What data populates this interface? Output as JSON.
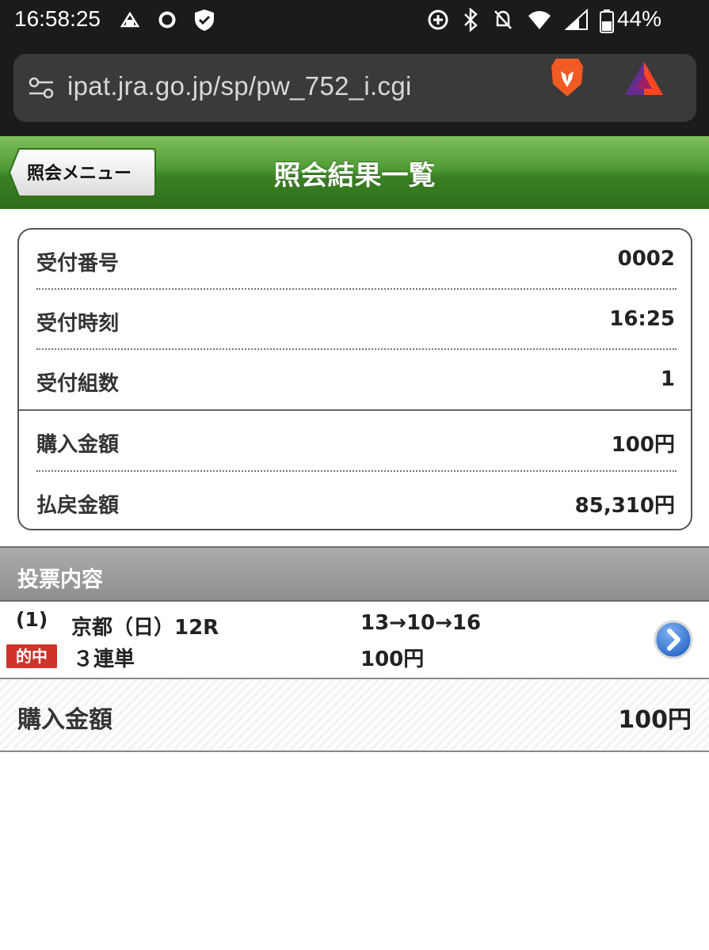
{
  "status_bar": {
    "time": "16:58:25",
    "battery": "44%"
  },
  "address_bar": {
    "url": "ipat.jra.go.jp/sp/pw_752_i.cgi"
  },
  "header": {
    "back_label": "照会メニュー",
    "title": "照会結果一覧"
  },
  "info": {
    "rows": [
      {
        "label": "受付番号",
        "value": "0002"
      },
      {
        "label": "受付時刻",
        "value": "16:25"
      },
      {
        "label": "受付組数",
        "value": "1"
      },
      {
        "label": "購入金額",
        "value": "100円"
      },
      {
        "label": "払戻金額",
        "value": "85,310円"
      }
    ]
  },
  "section": {
    "title": "投票内容"
  },
  "bet": {
    "number": "(1)",
    "race": "京都（日）12R",
    "combination": "13→10→16",
    "badge": "的中",
    "type": "３連単",
    "amount": "100円"
  },
  "total": {
    "label": "購入金額",
    "value": "100円"
  },
  "colors": {
    "header_green": "#3a8024",
    "badge_red": "#d0332a",
    "section_gray": "#9a9d9a"
  }
}
